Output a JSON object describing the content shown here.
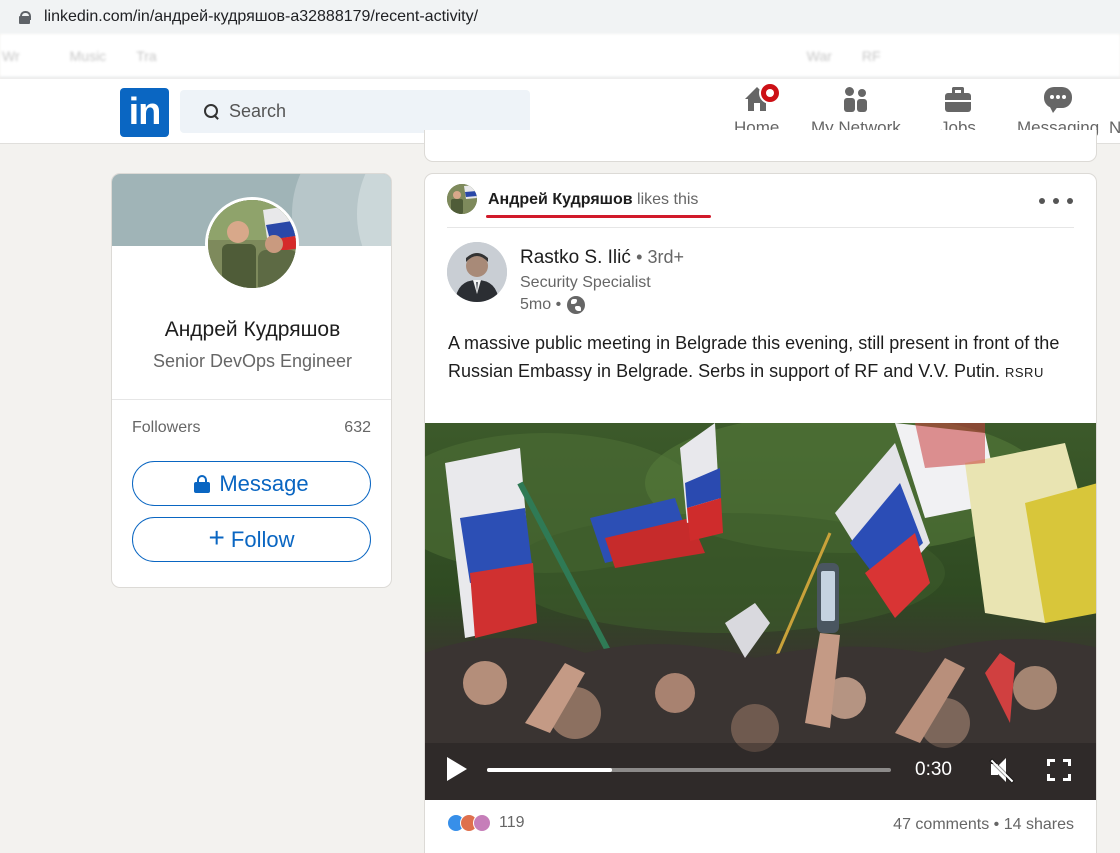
{
  "browser": {
    "url": "linkedin.com/in/андрей-кудряшов-a32888179/recent-activity/",
    "bookmarks": [
      "Wr",
      "Music",
      "Tra",
      "War",
      "RF"
    ]
  },
  "nav": {
    "logo": "in",
    "search_placeholder": "Search",
    "items": [
      {
        "label": "Home",
        "icon": "home-icon"
      },
      {
        "label": "My Network",
        "icon": "network-icon"
      },
      {
        "label": "Jobs",
        "icon": "briefcase-icon"
      },
      {
        "label": "Messaging",
        "icon": "messaging-icon"
      },
      {
        "label": "N",
        "icon": ""
      }
    ]
  },
  "profile": {
    "name": "Андрей Кудряшов",
    "headline": "Senior DevOps Engineer",
    "followers_label": "Followers",
    "followers_count": "632",
    "message_label": "Message",
    "follow_label": "Follow"
  },
  "post": {
    "liker_name": "Андрей Кудряшов",
    "liker_action": "likes this",
    "author_name": "Rastko S. Ilić",
    "author_degree": "• 3rd+",
    "author_title": "Security Specialist",
    "time": "5mo •",
    "text": "A massive public meeting in Belgrade this evening, still present in front of the Russian Embassy in Belgrade. Serbs in support of RF and V.V. Putin.",
    "text_tag": "RSRU",
    "video": {
      "time": "0:30",
      "progress_fraction": 0.31
    },
    "reactions_count": "119",
    "comments": "47 comments",
    "separator": "•",
    "shares": "14 shares"
  },
  "colors": {
    "brand": "#0a66c2",
    "notification": "#cc1016",
    "highlight_underline": "#d11a2a"
  }
}
